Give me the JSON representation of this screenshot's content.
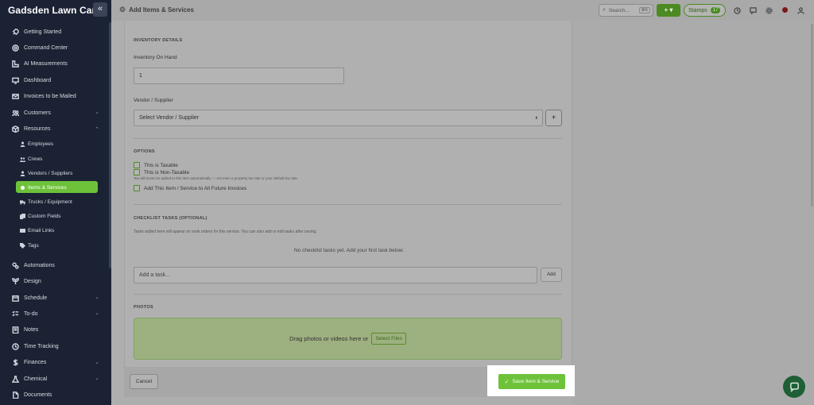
{
  "app": {
    "brand": "Gadsden Lawn Care",
    "collapse_glyph": "«"
  },
  "header": {
    "title": "Add Items & Services",
    "search_placeholder": "Search...",
    "search_shortcut": "⌘K",
    "add_label": "+ ▾",
    "stamps_label": "Stamps",
    "stamps_count": "17"
  },
  "sidebar": {
    "items": [
      {
        "label": "Getting Started",
        "icon": "rocket-icon"
      },
      {
        "label": "Command Center",
        "icon": "target-icon"
      },
      {
        "label": "AI Measurements",
        "icon": "ruler-icon"
      },
      {
        "label": "Dashboard",
        "icon": "monitor-icon"
      },
      {
        "label": "Invoices to be Mailed",
        "icon": "mail-icon"
      },
      {
        "label": "Customers",
        "icon": "users-icon"
      },
      {
        "label": "Resources",
        "icon": "box-icon"
      }
    ],
    "resources_sub": [
      {
        "label": "Employees"
      },
      {
        "label": "Crews"
      },
      {
        "label": "Vendors / Suppliers"
      },
      {
        "label": "Items & Services"
      },
      {
        "label": "Trucks / Equipment"
      },
      {
        "label": "Custom Fields"
      },
      {
        "label": "Email Links"
      },
      {
        "label": "Tags"
      }
    ],
    "items_after": [
      {
        "label": "Automations",
        "icon": "gears-icon"
      },
      {
        "label": "Design",
        "icon": "leaf-icon"
      },
      {
        "label": "Schedule",
        "icon": "calendar-icon"
      },
      {
        "label": "To-do",
        "icon": "checklist-icon"
      },
      {
        "label": "Notes",
        "icon": "note-icon"
      },
      {
        "label": "Time Tracking",
        "icon": "clock-icon"
      },
      {
        "label": "Finances",
        "icon": "dollar-icon"
      },
      {
        "label": "Chemical",
        "icon": "flask-icon"
      },
      {
        "label": "Documents",
        "icon": "document-icon"
      }
    ],
    "chevron_down": "⌄",
    "chevron_up": "⌃"
  },
  "form": {
    "inventory_section": "INVENTORY DETAILS",
    "inventory_label": "Inventory On Hand",
    "inventory_value": "1",
    "vendor_label": "Vendor / Supplier",
    "vendor_selected": "Select Vendor / Supplier",
    "vendor_add": "+",
    "options_section": "OPTIONS",
    "opt_taxable": "This is Taxable",
    "opt_non_taxable": "This is Non-Taxable",
    "non_taxable_note": "Tax will never be added to this item automatically — not even a property tax rate or your default tax rate.",
    "opt_future_invoices": "Add This Item / Service to All Future Invoices",
    "checklist_section": "CHECKLIST TASKS (OPTIONAL)",
    "checklist_note": "Tasks added here will appear on work orders for this service. You can also add or edit tasks after saving.",
    "checklist_empty": "No checklist tasks yet. Add your first task below.",
    "task_placeholder": "Add a task...",
    "add_task": "Add",
    "photos_section": "PHOTOS",
    "drop_text": "Drag photos or videos here or",
    "select_files": "Select Files"
  },
  "footer": {
    "cancel": "Cancel",
    "save": "Save Item & Service",
    "save_check": "✓"
  },
  "colors": {
    "accent": "#6dc23a",
    "sidebar_bg": "#1b2233"
  }
}
